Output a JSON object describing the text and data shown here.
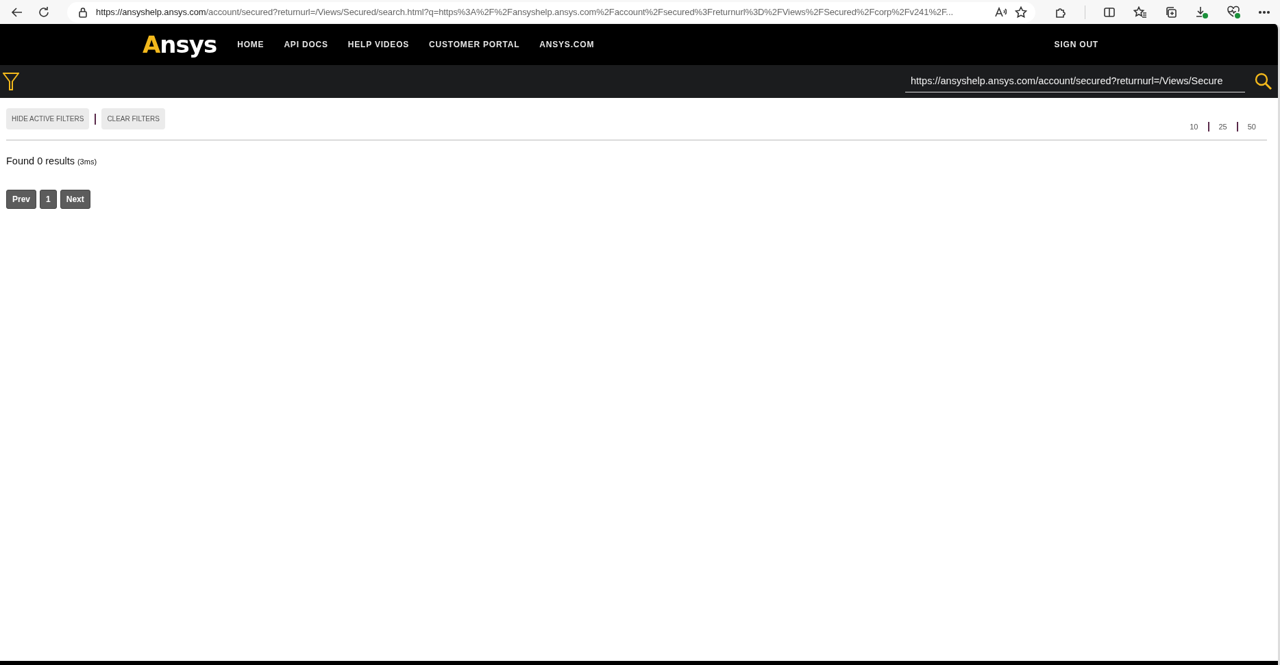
{
  "browser": {
    "url_host": "https://ansyshelp.ansys.com",
    "url_path": "/account/secured?returnurl=/Views/Secured/search.html?q=https%3A%2F%2Fansyshelp.ansys.com%2Faccount%2Fsecured%3Freturnurl%3D%2FViews%2FSecured%2Fcorp%2Fv241%2F..."
  },
  "header": {
    "logo": "Ansys",
    "nav": [
      {
        "label": "HOME"
      },
      {
        "label": "API DOCS"
      },
      {
        "label": "HELP VIDEOS"
      },
      {
        "label": "CUSTOMER PORTAL"
      },
      {
        "label": "ANSYS.COM"
      }
    ],
    "sign_out": "SIGN OUT"
  },
  "search": {
    "value": "https://ansyshelp.ansys.com/account/secured?returnurl=/Views/Secure"
  },
  "filters": {
    "buttons": [
      "HIDE ACTIVE FILTERS",
      "CLEAR FILTERS"
    ]
  },
  "page_sizes": [
    "10",
    "25",
    "50"
  ],
  "results": {
    "text": "Found 0 results",
    "timing": "(3ms)"
  },
  "pagination": [
    {
      "label": "Prev"
    },
    {
      "label": "1"
    },
    {
      "label": "Next"
    }
  ]
}
